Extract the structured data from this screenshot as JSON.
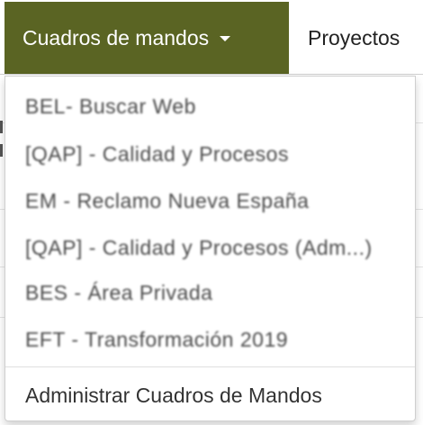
{
  "navbar": {
    "active_item": {
      "label": "Cuadros de mandos",
      "icon": "caret-down-icon"
    },
    "items": [
      {
        "label": "Proyectos"
      }
    ]
  },
  "dropdown": {
    "items": [
      {
        "label": "BEL- Buscar Web"
      },
      {
        "label": "[QAP] - Calidad y Procesos"
      },
      {
        "label": "EM - Reclamo Nueva España"
      },
      {
        "label": "[QAP] - Calidad y Procesos (Adm...)"
      },
      {
        "label": "BES - Área Privada"
      },
      {
        "label": "EFT - Transformación 2019"
      }
    ],
    "admin_item": {
      "label": "Administrar Cuadros de Mandos"
    }
  },
  "colors": {
    "active_nav_bg": "#5a6423",
    "active_nav_text": "#ffffff",
    "text": "#333333"
  }
}
